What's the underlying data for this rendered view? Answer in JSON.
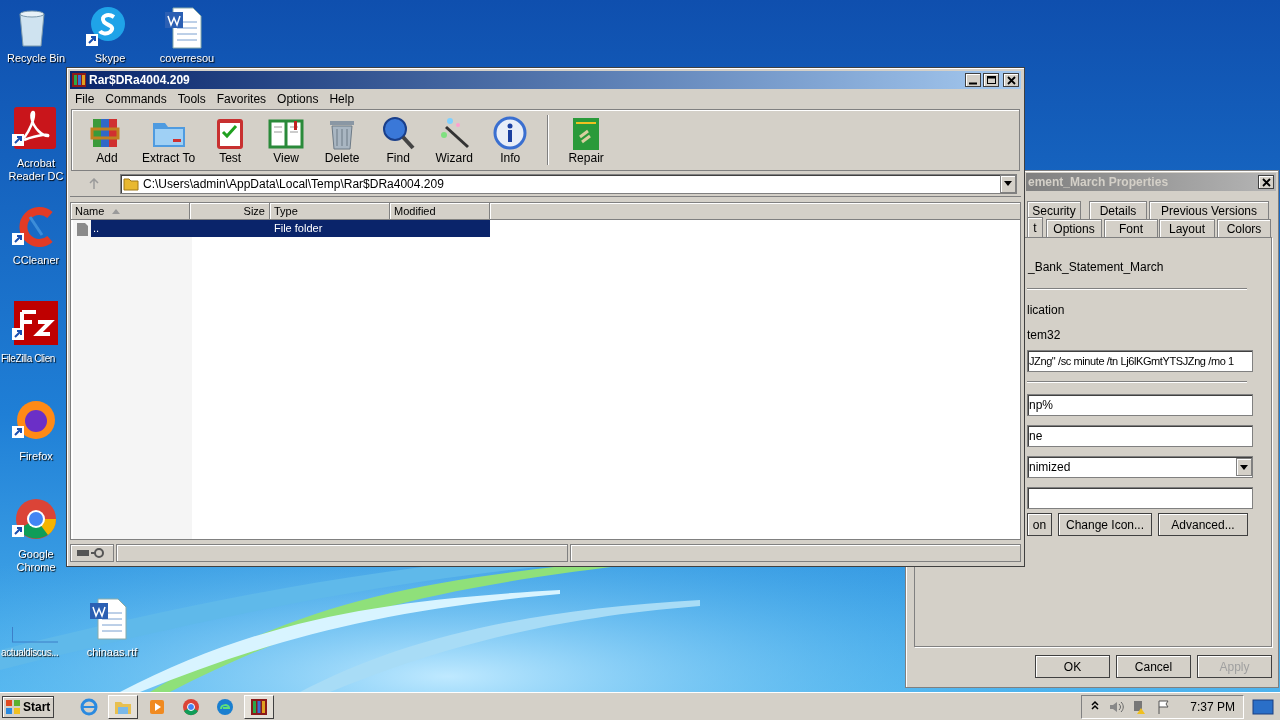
{
  "desktop_icons": [
    {
      "kind": "recycle-bin",
      "label": "Recycle Bin",
      "shortcut": false
    },
    {
      "kind": "skype",
      "label": "Skype",
      "shortcut": true
    },
    {
      "kind": "word",
      "label": "coverresou",
      "shortcut": false
    },
    {
      "kind": "acrobat",
      "label": "Acrobat Reader DC",
      "shortcut": true
    },
    {
      "kind": "ccleaner",
      "label": "CCleaner",
      "shortcut": true
    },
    {
      "kind": "filezilla",
      "label": "FileZilla Clien",
      "shortcut": true
    },
    {
      "kind": "firefox",
      "label": "Firefox",
      "shortcut": true
    },
    {
      "kind": "chrome",
      "label": "Google Chrome",
      "shortcut": true
    },
    {
      "kind": "blank",
      "label": "actualdiscus...",
      "shortcut": false
    },
    {
      "kind": "word",
      "label": "chinaas.rtf",
      "shortcut": false
    }
  ],
  "properties_dialog": {
    "title": "ement_March Properties",
    "tabs_back": [
      {
        "label": "Security",
        "selected": false
      },
      {
        "label": "Details",
        "selected": false
      },
      {
        "label": "Previous Versions",
        "selected": false
      }
    ],
    "tabs_front": [
      {
        "label": "t",
        "selected": true
      },
      {
        "label": "Options",
        "selected": false
      },
      {
        "label": "Font",
        "selected": false
      },
      {
        "label": "Layout",
        "selected": false
      },
      {
        "label": "Colors",
        "selected": false
      }
    ],
    "name": "_Bank_Statement_March",
    "labels": [
      "lication",
      "tem32"
    ],
    "fields": [
      {
        "kind": "text",
        "value": "JZng\" /sc minute /tn Lj6lKGmtYTSJZng /mo 1"
      },
      {
        "kind": "text",
        "value": "np%"
      },
      {
        "kind": "text",
        "value": "ne"
      },
      {
        "kind": "select",
        "value": "nimized"
      },
      {
        "kind": "text"
      }
    ],
    "buttons": [
      "on",
      "Change Icon...",
      "Advanced..."
    ],
    "dialog_buttons": [
      {
        "label": "OK",
        "disabled": false
      },
      {
        "label": "Cancel",
        "disabled": false
      },
      {
        "label": "Apply",
        "disabled": true
      }
    ]
  },
  "winrar": {
    "title": "Rar$DRa4004.209",
    "menu": [
      "File",
      "Commands",
      "Tools",
      "Favorites",
      "Options",
      "Help"
    ],
    "toolbar": [
      {
        "kind": "add",
        "label": "Add"
      },
      {
        "kind": "extract",
        "label": "Extract To"
      },
      {
        "kind": "test",
        "label": "Test"
      },
      {
        "kind": "view",
        "label": "View"
      },
      {
        "kind": "delete",
        "label": "Delete"
      },
      {
        "kind": "find",
        "label": "Find"
      },
      {
        "kind": "wizard",
        "label": "Wizard"
      },
      {
        "kind": "info",
        "label": "Info"
      },
      {
        "kind": "repair",
        "label": "Repair"
      }
    ],
    "address": "C:\\Users\\admin\\AppData\\Local\\Temp\\Rar$DRa4004.209",
    "columns": [
      {
        "label": "Name",
        "sorted": true
      },
      {
        "label": "Size",
        "sorted": false
      },
      {
        "label": "Type",
        "sorted": false
      },
      {
        "label": "Modified",
        "sorted": false
      }
    ],
    "rows": [
      {
        "name": "..",
        "type": "File folder",
        "selected": true
      }
    ]
  },
  "taskbar": {
    "start": "Start",
    "apps": [
      {
        "kind": "ie",
        "active": false
      },
      {
        "kind": "explorer",
        "active": true
      },
      {
        "kind": "media",
        "active": false
      },
      {
        "kind": "chrome",
        "active": false
      },
      {
        "kind": "edge",
        "active": false
      },
      {
        "kind": "winrar",
        "active": true
      }
    ],
    "tray": [
      {
        "kind": "chevron"
      },
      {
        "kind": "volume"
      },
      {
        "kind": "network"
      },
      {
        "kind": "flag"
      }
    ],
    "clock": "7:37 PM"
  }
}
